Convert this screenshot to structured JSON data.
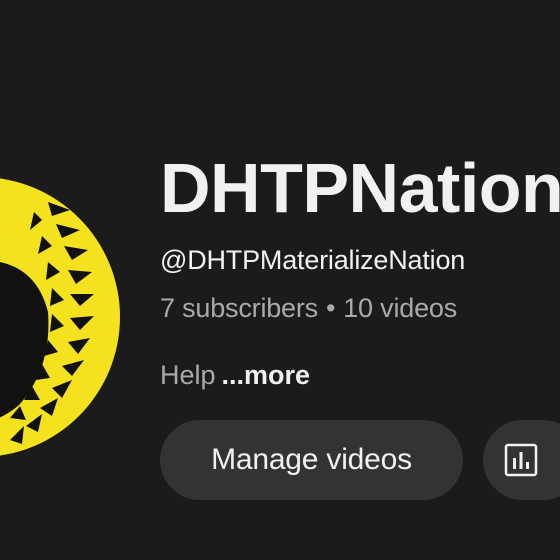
{
  "channel": {
    "name": "DHTPNation",
    "handle": "@DHTPMaterializeNation",
    "subscribers": "7 subscribers",
    "separator": "•",
    "videos": "10 videos",
    "description": "Help",
    "more_label": "...more"
  },
  "actions": {
    "manage_videos_label": "Manage videos",
    "analytics_icon": "bar-chart-icon"
  },
  "colors": {
    "background": "#1b1b1b",
    "avatar_yellow": "#f5e21e",
    "text_primary": "#f1f1f1",
    "text_secondary": "#aaaaaa",
    "button_bg": "#333333"
  }
}
